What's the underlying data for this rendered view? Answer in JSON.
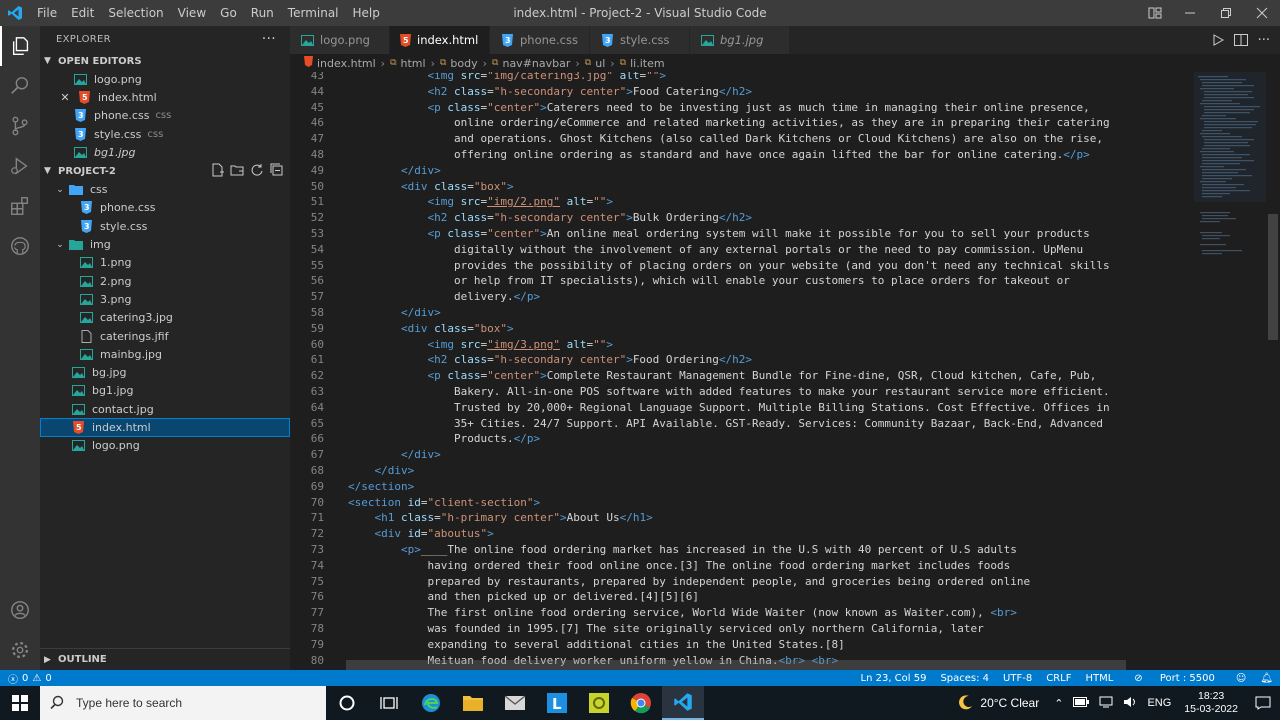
{
  "titlebar": {
    "menu": [
      "File",
      "Edit",
      "Selection",
      "View",
      "Go",
      "Run",
      "Terminal",
      "Help"
    ],
    "title": "index.html - Project-2 - Visual Studio Code"
  },
  "explorer": {
    "header": "EXPLORER",
    "open_editors_label": "OPEN EDITORS",
    "open_editors": [
      {
        "name": "logo.png",
        "type": "image"
      },
      {
        "name": "index.html",
        "type": "html",
        "active": true
      },
      {
        "name": "phone.css",
        "type": "css",
        "hint": "css"
      },
      {
        "name": "style.css",
        "type": "css",
        "hint": "css"
      },
      {
        "name": "bg1.jpg",
        "type": "image",
        "italic": true
      }
    ],
    "project_label": "PROJECT-2",
    "tree": {
      "css_folder": "css",
      "css_files": [
        "phone.css",
        "style.css"
      ],
      "img_folder": "img",
      "img_files": [
        "1.png",
        "2.png",
        "3.png",
        "catering3.jpg",
        "caterings.jfif",
        "mainbg.jpg"
      ],
      "root_files": [
        "bg.jpg",
        "bg1.jpg",
        "contact.jpg",
        "index.html",
        "logo.png"
      ]
    },
    "outline_label": "OUTLINE"
  },
  "tabs": [
    {
      "label": "logo.png",
      "type": "image"
    },
    {
      "label": "index.html",
      "type": "html",
      "active": true
    },
    {
      "label": "phone.css",
      "type": "css"
    },
    {
      "label": "style.css",
      "type": "css"
    },
    {
      "label": "bg1.jpg",
      "type": "image",
      "italic": true
    }
  ],
  "breadcrumb": [
    "index.html",
    "html",
    "body",
    "nav#navbar",
    "ul",
    "li.item"
  ],
  "editor": {
    "lines": [
      {
        "n": "43",
        "html": "            <span class=\"t\">&lt;img</span> <span class=\"a\">src</span>=<span class=\"s\">\"img/catering3.jpg\"</span> <span class=\"a\">alt</span>=<span class=\"s\">\"\"</span><span class=\"t\">&gt;</span>"
      },
      {
        "n": "44",
        "html": "            <span class=\"t\">&lt;h2</span> <span class=\"a\">class</span>=<span class=\"s\">\"h-secondary center\"</span><span class=\"t\">&gt;</span>Food Catering<span class=\"t\">&lt;/h2&gt;</span>"
      },
      {
        "n": "45",
        "html": "            <span class=\"t\">&lt;p</span> <span class=\"a\">class</span>=<span class=\"s\">\"center\"</span><span class=\"t\">&gt;</span>Caterers need to be investing just as much time in managing their online presence,"
      },
      {
        "n": "46",
        "html": "                online ordering/eCommerce and related marketing activities, as they are in preparing their catering"
      },
      {
        "n": "47",
        "html": "                and operations. Ghost Kitchens (also called Dark Kitchens or Cloud Kitchens) are also on the rise,"
      },
      {
        "n": "48",
        "html": "                offering online ordering as standard and have once again lifted the bar for online catering.<span class=\"t\">&lt;/p&gt;</span>"
      },
      {
        "n": "49",
        "html": "        <span class=\"t\">&lt;/div&gt;</span>"
      },
      {
        "n": "50",
        "html": "        <span class=\"t\">&lt;div</span> <span class=\"a\">class</span>=<span class=\"s\">\"box\"</span><span class=\"t\">&gt;</span>"
      },
      {
        "n": "51",
        "html": "            <span class=\"t\">&lt;img</span> <span class=\"a\">src</span>=<span class=\"u\">\"img/2.png\"</span> <span class=\"a\">alt</span>=<span class=\"s\">\"\"</span><span class=\"t\">&gt;</span>"
      },
      {
        "n": "52",
        "html": "            <span class=\"t\">&lt;h2</span> <span class=\"a\">class</span>=<span class=\"s\">\"h-secondary center\"</span><span class=\"t\">&gt;</span>Bulk Ordering<span class=\"t\">&lt;/h2&gt;</span>"
      },
      {
        "n": "53",
        "html": "            <span class=\"t\">&lt;p</span> <span class=\"a\">class</span>=<span class=\"s\">\"center\"</span><span class=\"t\">&gt;</span>An online meal ordering system will make it possible for you to sell your products"
      },
      {
        "n": "54",
        "html": "                digitally without the involvement of any external portals or the need to pay commission. UpMenu"
      },
      {
        "n": "55",
        "html": "                provides the possibility of placing orders on your website (and you don't need any technical skills"
      },
      {
        "n": "56",
        "html": "                or help from IT specialists), which will enable your customers to place orders for takeout or"
      },
      {
        "n": "57",
        "html": "                delivery.<span class=\"t\">&lt;/p&gt;</span>"
      },
      {
        "n": "58",
        "html": "        <span class=\"t\">&lt;/div&gt;</span>"
      },
      {
        "n": "59",
        "html": "        <span class=\"t\">&lt;div</span> <span class=\"a\">class</span>=<span class=\"s\">\"box\"</span><span class=\"t\">&gt;</span>"
      },
      {
        "n": "60",
        "html": "            <span class=\"t\">&lt;img</span> <span class=\"a\">src</span>=<span class=\"u\">\"img/3.png\"</span> <span class=\"a\">alt</span>=<span class=\"s\">\"\"</span><span class=\"t\">&gt;</span>"
      },
      {
        "n": "61",
        "html": "            <span class=\"t\">&lt;h2</span> <span class=\"a\">class</span>=<span class=\"s\">\"h-secondary center\"</span><span class=\"t\">&gt;</span>Food Ordering<span class=\"t\">&lt;/h2&gt;</span>"
      },
      {
        "n": "62",
        "html": "            <span class=\"t\">&lt;p</span> <span class=\"a\">class</span>=<span class=\"s\">\"center\"</span><span class=\"t\">&gt;</span>Complete Restaurant Management Bundle for Fine-dine, QSR, Cloud kitchen, Cafe, Pub,"
      },
      {
        "n": "63",
        "html": "                Bakery. All-in-one POS software with added features to make your restaurant service more efficient."
      },
      {
        "n": "64",
        "html": "                Trusted by 20,000+ Regional Language Support. Multiple Billing Stations. Cost Effective. Offices in"
      },
      {
        "n": "65",
        "html": "                35+ Cities. 24/7 Support. API Available. GST-Ready. Services: Community Bazaar, Back-End, Advanced"
      },
      {
        "n": "66",
        "html": "                Products.<span class=\"t\">&lt;/p&gt;</span>"
      },
      {
        "n": "67",
        "html": "        <span class=\"t\">&lt;/div&gt;</span>"
      },
      {
        "n": "68",
        "html": "    <span class=\"t\">&lt;/div&gt;</span>"
      },
      {
        "n": "69",
        "html": "<span class=\"t\">&lt;/section&gt;</span>"
      },
      {
        "n": "70",
        "html": "<span class=\"t\">&lt;section</span> <span class=\"a\">id</span>=<span class=\"s\">\"client-section\"</span><span class=\"t\">&gt;</span>"
      },
      {
        "n": "71",
        "html": "    <span class=\"t\">&lt;h1</span> <span class=\"a\">class</span>=<span class=\"s\">\"h-primary center\"</span><span class=\"t\">&gt;</span>About Us<span class=\"t\">&lt;/h1&gt;</span>"
      },
      {
        "n": "72",
        "html": "    <span class=\"t\">&lt;div</span> <span class=\"a\">id</span>=<span class=\"s\">\"aboutus\"</span><span class=\"t\">&gt;</span>"
      },
      {
        "n": "73",
        "html": "        <span class=\"t\">&lt;p&gt;</span>____The online food ordering market has increased in the U.S with 40 percent of U.S adults"
      },
      {
        "n": "74",
        "html": "            having ordered their food online once.[3] The online food ordering market includes foods"
      },
      {
        "n": "75",
        "html": "            prepared by restaurants, prepared by independent people, and groceries being ordered online"
      },
      {
        "n": "76",
        "html": "            and then picked up or delivered.[4][5][6]"
      },
      {
        "n": "77",
        "html": "            The first online food ordering service, World Wide Waiter (now known as Waiter.com), <span class=\"t\">&lt;br&gt;</span>"
      },
      {
        "n": "78",
        "html": "            was founded in 1995.[7] The site originally serviced only northern California, later"
      },
      {
        "n": "79",
        "html": "            expanding to several additional cities in the United States.[8]"
      },
      {
        "n": "80",
        "html": "            Meituan food delivery worker uniform yellow in China.<span class=\"t\">&lt;br&gt;</span> <span class=\"t\">&lt;br&gt;</span>"
      }
    ]
  },
  "statusbar": {
    "errors": "0",
    "warnings": "0",
    "position": "Ln 23, Col 59",
    "spaces": "Spaces: 4",
    "encoding": "UTF-8",
    "eol": "CRLF",
    "language": "HTML",
    "port": "Port : 5500"
  },
  "taskbar": {
    "search_placeholder": "Type here to search",
    "weather": "20°C  Clear",
    "lang": "ENG",
    "time": "18:23",
    "date": "15-03-2022"
  },
  "colors": {
    "accent": "#007acc",
    "html_icon": "#e44d26",
    "css_icon": "#42a5f5",
    "image_icon": "#26a69a"
  }
}
